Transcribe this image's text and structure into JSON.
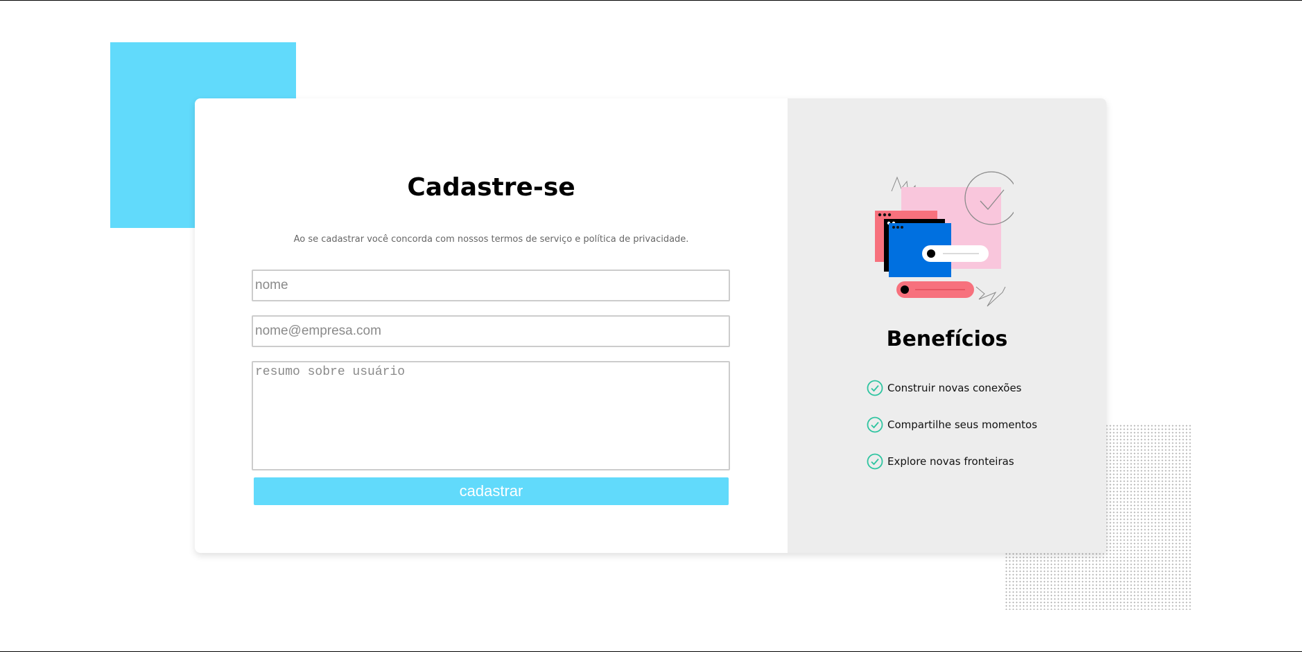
{
  "form": {
    "title": "Cadastre-se",
    "subtitle": "Ao se cadastrar você concorda com nossos termos de serviço e política de privacidade.",
    "name_placeholder": "nome",
    "email_placeholder": "nome@empresa.com",
    "summary_placeholder": "resumo sobre usuário",
    "submit_label": "cadastrar"
  },
  "benefits": {
    "title": "Benefícios",
    "items": [
      {
        "label": "Construir novas conexões"
      },
      {
        "label": "Compartilhe seus momentos"
      },
      {
        "label": "Explore novas fronteiras"
      }
    ]
  },
  "colors": {
    "accent": "#61dafb",
    "check": "#2ec4a0",
    "panel": "#ededed"
  }
}
